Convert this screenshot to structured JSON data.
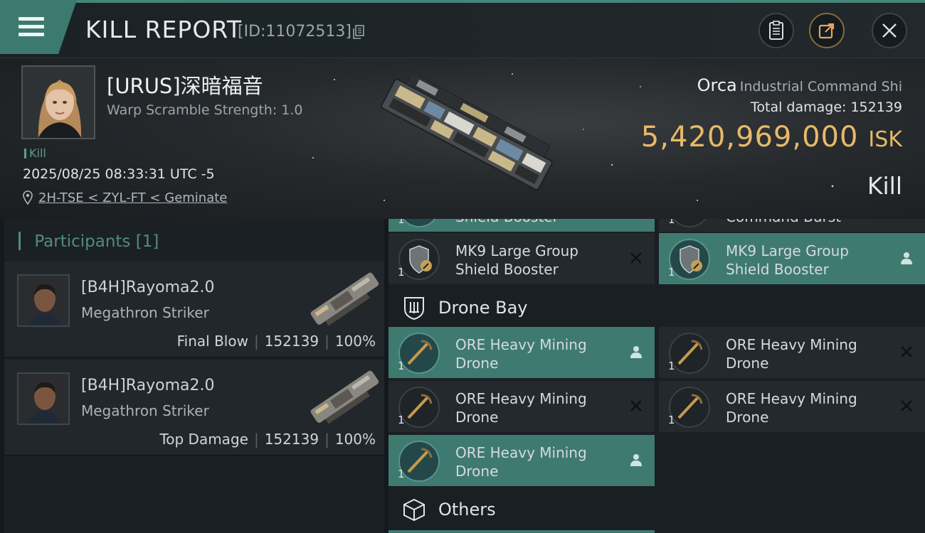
{
  "header": {
    "title": "KILL REPORT",
    "report_id": "[ID:11072513]"
  },
  "victim": {
    "name": "[URUS]深暗福音",
    "scramble": "Warp Scramble Strength: 1.0",
    "tag": "Kill",
    "timestamp": "2025/08/25 08:33:31 UTC -5",
    "location": "2H-TSE < ZYL-FT < Geminate",
    "ship": "Orca",
    "ship_class": "Industrial Command Shi",
    "total_damage_label": "Total damage:",
    "total_damage": "152139",
    "isk_value": "5,420,969,000",
    "isk_unit": "ISK",
    "result": "Kill"
  },
  "participants": {
    "label": "Participants",
    "count": "[1]",
    "rows": [
      {
        "name": "[B4H]Rayoma2.0",
        "ship": "Megathron Striker",
        "role": "Final Blow",
        "damage": "152139",
        "percent": "100%"
      },
      {
        "name": "[B4H]Rayoma2.0",
        "ship": "Megathron Striker",
        "role": "Top Damage",
        "damage": "152139",
        "percent": "100%"
      }
    ]
  },
  "fitting": {
    "top_partial": [
      {
        "label": "Shield Booster",
        "qty": "1",
        "state": "dropped"
      },
      {
        "label": "Command Burst",
        "qty": "1",
        "state": "destroyed"
      }
    ],
    "shield_row": [
      {
        "name": "MK9 Large Group Shield Booster",
        "qty": "1",
        "state": "destroyed",
        "status_icon": "x-icon"
      },
      {
        "name": "MK9 Large Group Shield Booster",
        "qty": "1",
        "state": "dropped",
        "status_icon": "person-icon"
      }
    ],
    "drone_bay_label": "Drone Bay",
    "drones": [
      {
        "name": "ORE Heavy Mining Drone",
        "qty": "1",
        "state": "dropped",
        "status_icon": "person-icon"
      },
      {
        "name": "ORE Heavy Mining Drone",
        "qty": "1",
        "state": "destroyed",
        "status_icon": "x-icon"
      },
      {
        "name": "ORE Heavy Mining Drone",
        "qty": "1",
        "state": "destroyed",
        "status_icon": "x-icon"
      },
      {
        "name": "ORE Heavy Mining Drone",
        "qty": "1",
        "state": "destroyed",
        "status_icon": "x-icon"
      },
      {
        "name": "ORE Heavy Mining Drone",
        "qty": "1",
        "state": "dropped",
        "status_icon": "person-icon"
      }
    ],
    "others_label": "Others"
  },
  "colors": {
    "accent_teal": "#3f7a70",
    "isk_gold": "#e8b968",
    "background": "#15191d"
  }
}
